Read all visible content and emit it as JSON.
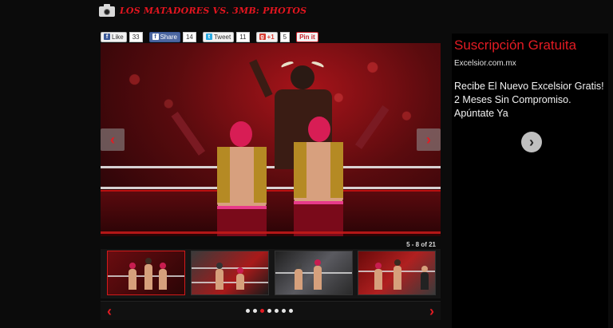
{
  "gallery": {
    "title": "LOS MATADORES VS. 3MB: PHOTOS",
    "counter": "5 - 8 of 21",
    "prev_icon": "‹",
    "next_icon": "›",
    "pager": {
      "total_dots": 7,
      "active_dot": 2
    }
  },
  "share": {
    "fb_like": {
      "label": "Like",
      "count": "33"
    },
    "fb_share": {
      "label": "Share",
      "count": "14"
    },
    "tweet": {
      "label": "Tweet",
      "count": "11"
    },
    "gplus": {
      "label": "+1",
      "count": "5"
    },
    "pinit": {
      "label": "Pin it"
    }
  },
  "ad": {
    "headline": "Suscripción Gratuita",
    "domain": "Excelsior.com.mx",
    "body": "Recibe El Nuevo Excelsior Gratis! 2 Meses Sin Compromiso. Apúntate Ya",
    "go_icon": "›"
  },
  "colors": {
    "accent": "#e31b23",
    "background": "#0b0b0b"
  }
}
